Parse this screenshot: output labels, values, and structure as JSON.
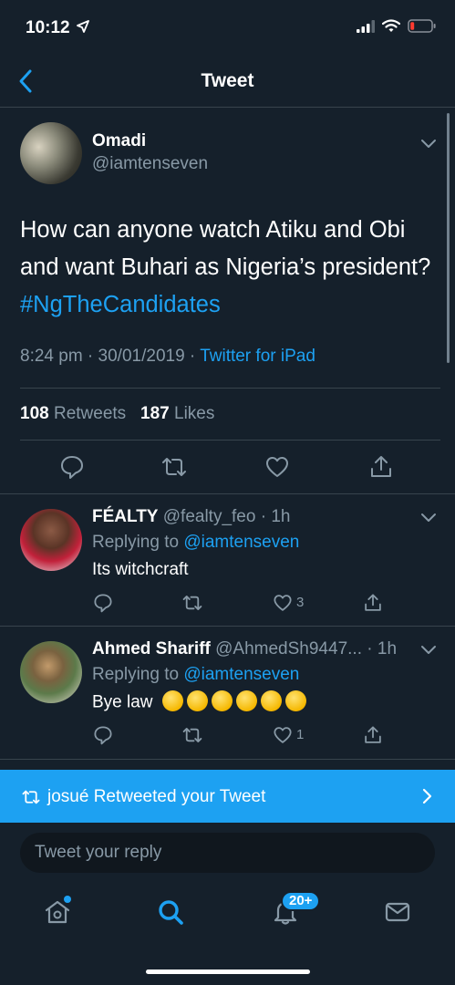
{
  "status_bar": {
    "time": "10:12"
  },
  "nav": {
    "title": "Tweet"
  },
  "tweet": {
    "author_name": "Omadi",
    "author_handle": "@iamtenseven",
    "text": "How can anyone watch Atiku and Obi and want Buhari as Nigeria’s president?",
    "hashtag": "#NgTheCandidates",
    "time": "8:24 pm",
    "date": "30/01/2019",
    "source": "Twitter for iPad",
    "retweets_count": "108",
    "retweets_label": "Retweets",
    "likes_count": "187",
    "likes_label": "Likes"
  },
  "replies": [
    {
      "name": "FÉALTY",
      "handle": "@fealty_feo",
      "age": "1h",
      "replying_prefix": "Replying to",
      "replying_to": "@iamtenseven",
      "text": "Its witchcraft",
      "like_count": "3"
    },
    {
      "name": "Ahmed Shariff",
      "handle": "@AhmedSh9447...",
      "age": "1h",
      "replying_prefix": "Replying to",
      "replying_to": "@iamtenseven",
      "text": "Bye law",
      "like_count": "1"
    }
  ],
  "banner": {
    "text": "josué Retweeted your Tweet"
  },
  "composer": {
    "placeholder": "Tweet your reply"
  },
  "tabbar": {
    "notifications_badge": "20+"
  },
  "colors": {
    "background": "#15202b",
    "accent": "#1da1f2",
    "muted": "#8899a6",
    "divider": "#38444d"
  },
  "icons": [
    "location-arrow-icon",
    "signal-icon",
    "wifi-icon",
    "battery-icon",
    "back-chevron-icon",
    "chevron-down-icon",
    "reply-icon",
    "retweet-icon",
    "like-icon",
    "share-icon",
    "home-icon",
    "search-icon",
    "bell-icon",
    "mail-icon",
    "chevron-right-icon"
  ]
}
